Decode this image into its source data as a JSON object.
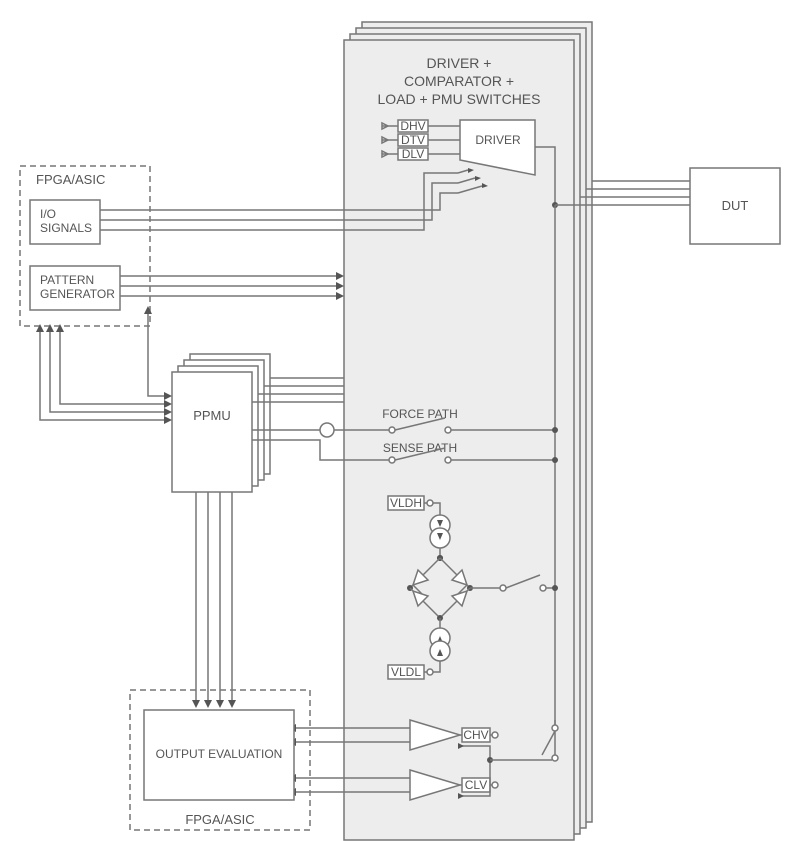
{
  "fpga_top": {
    "title": "FPGA/ASIC",
    "io_signals": "I/O SIGNALS",
    "pattern_generator": "PATTERN GENERATOR"
  },
  "ppmu": {
    "label": "PPMU"
  },
  "main": {
    "title_line1": "DRIVER +",
    "title_line2": "COMPARATOR +",
    "title_line3": "LOAD + PMU SWITCHES",
    "driver": {
      "label": "DRIVER",
      "inputs": {
        "dhv": "DHV",
        "dtv": "DTV",
        "dlv": "DLV"
      }
    },
    "force_path": "FORCE PATH",
    "sense_path": "SENSE PATH",
    "vldh": "VLDH",
    "vldl": "VLDL",
    "chv": "CHV",
    "clv": "CLV"
  },
  "dut": {
    "label": "DUT"
  },
  "fpga_bottom": {
    "title": "FPGA/ASIC",
    "output_evaluation": "OUTPUT EVALUATION"
  }
}
